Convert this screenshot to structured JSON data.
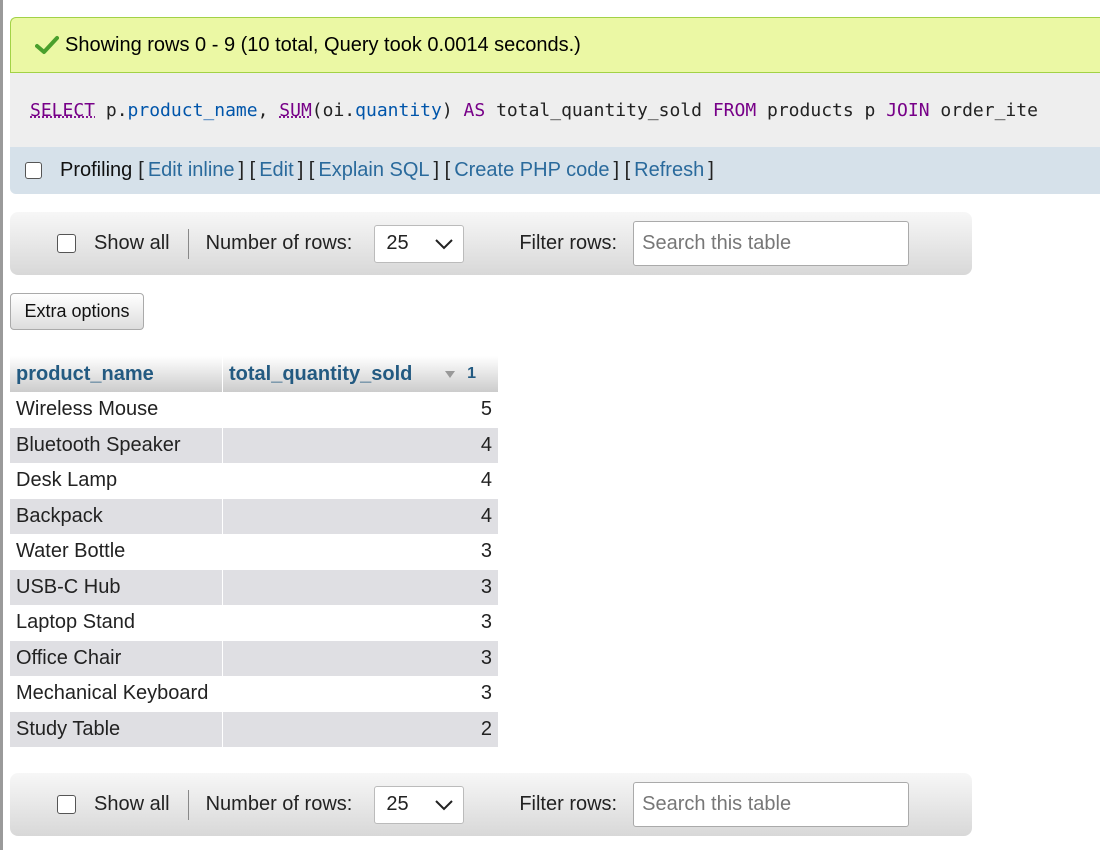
{
  "success_message": "Showing rows 0 - 9 (10 total, Query took 0.0014 seconds.)",
  "sql": {
    "tokens": [
      {
        "t": "SELECT",
        "c": "kwu"
      },
      {
        "t": " p.",
        "c": "plain"
      },
      {
        "t": "product_name",
        "c": "var"
      },
      {
        "t": ", ",
        "c": "plain"
      },
      {
        "t": "SUM",
        "c": "fn"
      },
      {
        "t": "(oi.",
        "c": "plain"
      },
      {
        "t": "quantity",
        "c": "var"
      },
      {
        "t": ") ",
        "c": "plain"
      },
      {
        "t": "AS",
        "c": "kw"
      },
      {
        "t": " total_quantity_sold ",
        "c": "plain"
      },
      {
        "t": "FROM",
        "c": "kw"
      },
      {
        "t": " products p ",
        "c": "plain"
      },
      {
        "t": "JOIN",
        "c": "kw"
      },
      {
        "t": " order_ite",
        "c": "plain"
      }
    ]
  },
  "profiling": {
    "label": "Profiling",
    "links": [
      "Edit inline",
      "Edit",
      "Explain SQL",
      "Create PHP code",
      "Refresh"
    ]
  },
  "nav": {
    "show_all": "Show all",
    "number_of_rows_label": "Number of rows:",
    "rows_value": "25",
    "filter_label": "Filter rows:",
    "search_placeholder": "Search this table"
  },
  "extra_options": "Extra options",
  "table": {
    "columns": [
      "product_name",
      "total_quantity_sold"
    ],
    "sort_index": "1",
    "rows": [
      [
        "Wireless Mouse",
        "5"
      ],
      [
        "Bluetooth Speaker",
        "4"
      ],
      [
        "Desk Lamp",
        "4"
      ],
      [
        "Backpack",
        "4"
      ],
      [
        "Water Bottle",
        "3"
      ],
      [
        "USB-C Hub",
        "3"
      ],
      [
        "Laptop Stand",
        "3"
      ],
      [
        "Office Chair",
        "3"
      ],
      [
        "Mechanical Keyboard",
        "3"
      ],
      [
        "Study Table",
        "2"
      ]
    ]
  },
  "colors": {
    "success_bg": "#ebf8a4",
    "link": "#2a6a9c",
    "header_text": "#235a81",
    "sql_keyword": "#770088",
    "sql_column": "#0055aa"
  }
}
